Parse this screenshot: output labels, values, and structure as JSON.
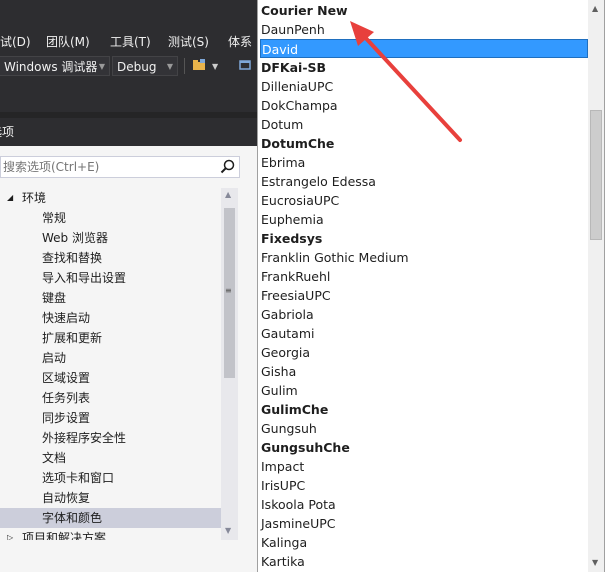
{
  "menu": {
    "items": [
      "试(D)",
      "团队(M)",
      "工具(T)",
      "测试(S)",
      "体系"
    ]
  },
  "toolbar": {
    "platform": "Windows 调试器",
    "config": "Debug"
  },
  "dialog": {
    "title": "选项"
  },
  "search": {
    "placeholder": "搜索选项(Ctrl+E)"
  },
  "tree": {
    "root": "环境",
    "items": [
      "常规",
      "Web 浏览器",
      "查找和替换",
      "导入和导出设置",
      "键盘",
      "快速启动",
      "扩展和更新",
      "启动",
      "区域设置",
      "任务列表",
      "同步设置",
      "外接程序安全性",
      "文档",
      "选项卡和窗口",
      "自动恢复",
      "字体和颜色"
    ],
    "selected": "字体和颜色",
    "next_root": "项目和解决方案"
  },
  "font_list": {
    "items": [
      {
        "name": "Courier New",
        "bold": true
      },
      {
        "name": "DaunPenh",
        "bold": false
      },
      {
        "name": "David",
        "bold": false,
        "selected": true
      },
      {
        "name": "DFKai-SB",
        "bold": true
      },
      {
        "name": "DilleniaUPC",
        "bold": false
      },
      {
        "name": "DokChampa",
        "bold": false
      },
      {
        "name": "Dotum",
        "bold": false
      },
      {
        "name": "DotumChe",
        "bold": true
      },
      {
        "name": "Ebrima",
        "bold": false
      },
      {
        "name": "Estrangelo Edessa",
        "bold": false
      },
      {
        "name": "EucrosiaUPC",
        "bold": false
      },
      {
        "name": "Euphemia",
        "bold": false
      },
      {
        "name": "Fixedsys",
        "bold": true
      },
      {
        "name": "Franklin Gothic Medium",
        "bold": false
      },
      {
        "name": "FrankRuehl",
        "bold": false
      },
      {
        "name": "FreesiaUPC",
        "bold": false
      },
      {
        "name": "Gabriola",
        "bold": false
      },
      {
        "name": "Gautami",
        "bold": false
      },
      {
        "name": "Georgia",
        "bold": false
      },
      {
        "name": "Gisha",
        "bold": false
      },
      {
        "name": "Gulim",
        "bold": false
      },
      {
        "name": "GulimChe",
        "bold": true
      },
      {
        "name": "Gungsuh",
        "bold": false
      },
      {
        "name": "GungsuhChe",
        "bold": true
      },
      {
        "name": "Impact",
        "bold": false
      },
      {
        "name": "IrisUPC",
        "bold": false
      },
      {
        "name": "Iskoola Pota",
        "bold": false
      },
      {
        "name": "JasmineUPC",
        "bold": false
      },
      {
        "name": "Kalinga",
        "bold": false
      },
      {
        "name": "Kartika",
        "bold": false
      }
    ]
  },
  "colors": {
    "ide_dark": "#2d2d30",
    "selection": "#3399ff",
    "tree_selection": "#cccedb",
    "annotation_arrow": "#e8403c"
  },
  "icons": [
    "search-icon",
    "folder-icon",
    "tree-expand-arrow-icon",
    "tree-collapse-arrow-icon",
    "scroll-up-arrow-icon",
    "scroll-down-arrow-icon",
    "dropdown-arrow-icon",
    "annotation-arrow"
  ]
}
